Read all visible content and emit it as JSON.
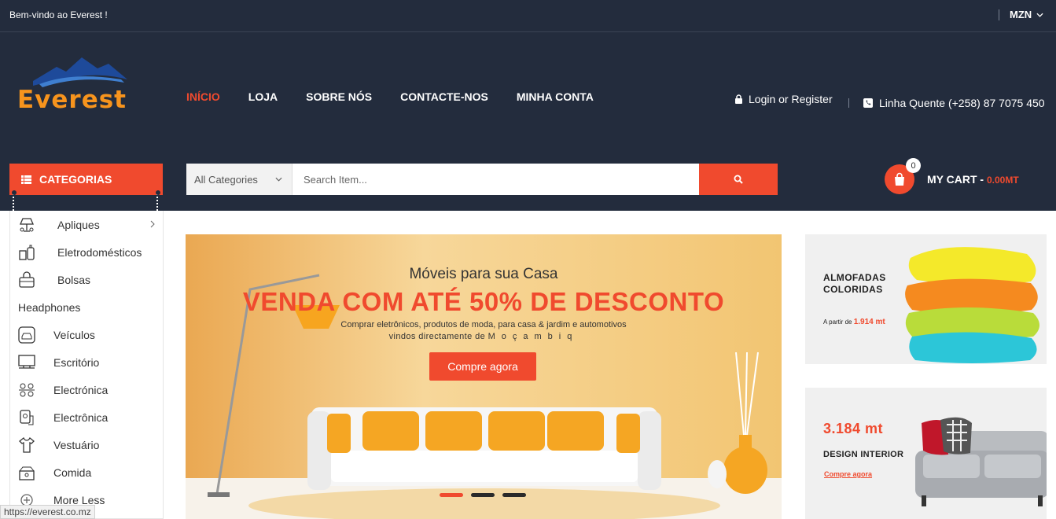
{
  "topbar": {
    "welcome": "Bem-vindo ao Everest !",
    "currency": "MZN"
  },
  "brand": {
    "name": "Everest",
    "colors": {
      "dark": "#232c3d",
      "accent": "#f04a2e",
      "logo": "#f7941d"
    }
  },
  "nav": [
    {
      "label": "INÍCIO",
      "active": true
    },
    {
      "label": "LOJA"
    },
    {
      "label": "SOBRE NÓS"
    },
    {
      "label": "CONTACTE-NOS"
    },
    {
      "label": "MINHA CONTA"
    }
  ],
  "account": {
    "login_label": "Login or Register",
    "hotline": "Linha Quente (+258) 87 7075 450"
  },
  "categories_button": "CATEGORIAS",
  "search": {
    "category": "All Categories",
    "placeholder": "Search Item..."
  },
  "cart": {
    "count": "0",
    "label": "MY CART - ",
    "amount": "0.00MT"
  },
  "categories": [
    {
      "label": "Apliques",
      "icon": "lamp-icon",
      "has_sub": true
    },
    {
      "label": "Eletrodomésticos",
      "icon": "appliances-icon"
    },
    {
      "label": "Bolsas",
      "icon": "bag-icon"
    },
    {
      "label": "Headphones",
      "icon": ""
    },
    {
      "label": "Veículos",
      "icon": "car-icon"
    },
    {
      "label": "Escritório",
      "icon": "office-icon"
    },
    {
      "label": "Electrónica",
      "icon": "electronics-icon"
    },
    {
      "label": "Electrônica",
      "icon": "device-icon"
    },
    {
      "label": "Vestuário",
      "icon": "clothing-icon"
    },
    {
      "label": "Comida",
      "icon": "food-icon"
    },
    {
      "label": "More Less",
      "icon": "plus-circle-icon"
    }
  ],
  "banner": {
    "subtitle": "Móveis para sua Casa",
    "headline": "VENDA COM ATÉ 50% DE DESCONTO",
    "desc1": "Comprar eletrônicos, produtos de moda, para casa & jardim e automotivos",
    "desc2_prefix": "vindos directamente de",
    "desc2_place": "Moçambiq",
    "cta": "Compre agora",
    "slides": 3,
    "active_slide": 1
  },
  "promo1": {
    "line1": "ALMOFADAS",
    "line2": "COLORIDAS",
    "price_prefix": "A partir de",
    "price": "1.914 mt"
  },
  "promo2": {
    "price": "3.184 mt",
    "title": "DESIGN INTERIOR",
    "link": "Compre agora"
  },
  "status_url": "https://everest.co.mz"
}
